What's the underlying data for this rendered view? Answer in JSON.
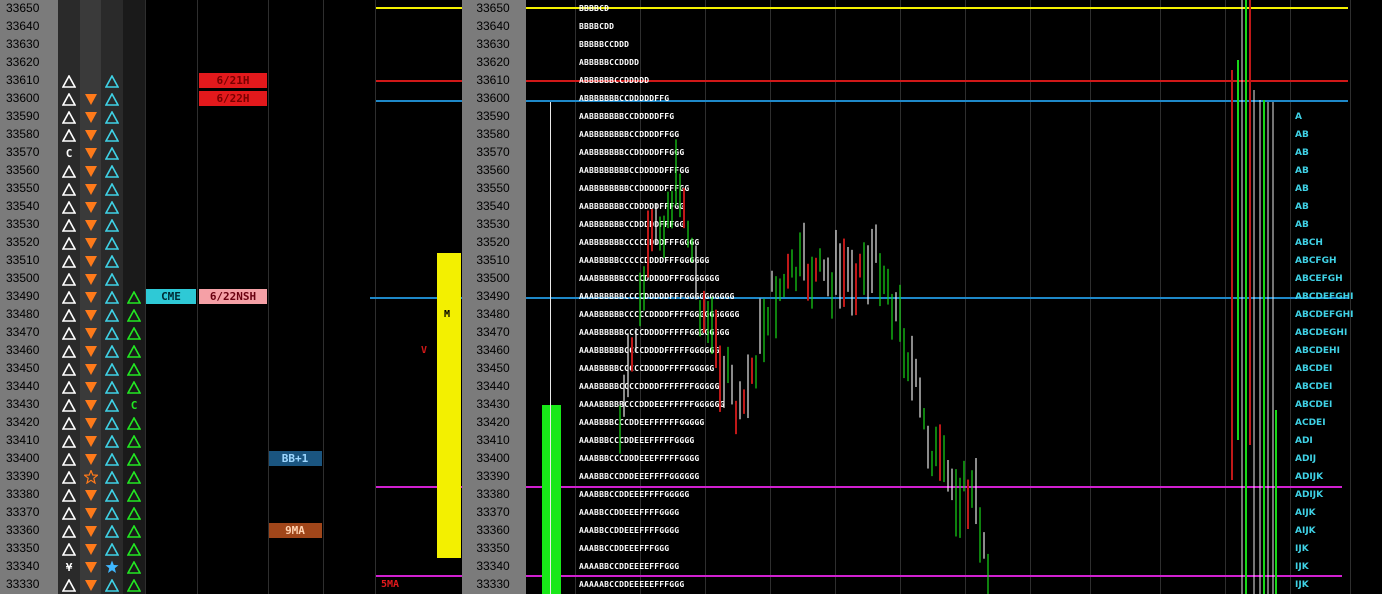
{
  "prices": [
    "33650",
    "33640",
    "33630",
    "33620",
    "33610",
    "33600",
    "33590",
    "33580",
    "33570",
    "33560",
    "33550",
    "33540",
    "33530",
    "33520",
    "33510",
    "33500",
    "33490",
    "33480",
    "33470",
    "33460",
    "33450",
    "33440",
    "33430",
    "33420",
    "33410",
    "33400",
    "33390",
    "33380",
    "33370",
    "33360",
    "33350",
    "33340",
    "33330"
  ],
  "signals": {
    "col1": [
      "",
      "",
      "",
      "",
      "tri-w",
      "tri-w",
      "tri-w",
      "tri-w",
      "C",
      "tri-w",
      "tri-w",
      "tri-w",
      "tri-w",
      "tri-w",
      "tri-w",
      "tri-w",
      "tri-w",
      "tri-w",
      "tri-w",
      "tri-w",
      "tri-w",
      "tri-w",
      "tri-w",
      "tri-w",
      "tri-w",
      "tri-w",
      "tri-w",
      "tri-w",
      "tri-w",
      "tri-w",
      "tri-w",
      "¥",
      "tri-w"
    ],
    "col2": [
      "",
      "",
      "",
      "",
      "",
      "down",
      "down",
      "down",
      "down",
      "down",
      "down",
      "down",
      "down",
      "down",
      "down",
      "down",
      "down",
      "down",
      "down",
      "down",
      "down",
      "down",
      "down",
      "down",
      "down",
      "down",
      "star-o",
      "down",
      "down",
      "down",
      "down",
      "down",
      "down"
    ],
    "col3": [
      "",
      "",
      "",
      "",
      "tri-c",
      "tri-c",
      "tri-c",
      "tri-c",
      "tri-c",
      "tri-c",
      "tri-c",
      "tri-c",
      "tri-c",
      "tri-c",
      "tri-c",
      "tri-c",
      "tri-c",
      "tri-c",
      "tri-c",
      "tri-c",
      "tri-c",
      "tri-c",
      "tri-c",
      "tri-c",
      "tri-c",
      "tri-c",
      "tri-c",
      "tri-c",
      "tri-c",
      "tri-c",
      "tri-c",
      "star-c",
      "tri-c"
    ],
    "col4": [
      "",
      "",
      "",
      "",
      "",
      "",
      "",
      "",
      "",
      "",
      "",
      "",
      "",
      "",
      "",
      "",
      "tri-g",
      "tri-g",
      "tri-g",
      "tri-g",
      "tri-g",
      "tri-g",
      "C",
      "tri-g",
      "tri-g",
      "tri-g",
      "tri-g",
      "tri-g",
      "tri-g",
      "tri-g",
      "tri-g",
      "tri-g",
      "tri-g"
    ]
  },
  "badges": [
    {
      "text": "6/21H",
      "row": 4,
      "col": "b",
      "bg": "#e3191c",
      "fg": "#7a0000"
    },
    {
      "text": "6/22H",
      "row": 5,
      "col": "b",
      "bg": "#e3191c",
      "fg": "#7a0000"
    },
    {
      "text": "CME",
      "row": 16,
      "col": "a",
      "bg": "#2ec9d6",
      "fg": "#002a33"
    },
    {
      "text": "6/22NSH",
      "row": 16,
      "col": "b",
      "bg": "#f5a0a6",
      "fg": "#6a0010"
    },
    {
      "text": "BB+1",
      "row": 25,
      "col": "c",
      "bg": "#1a5580",
      "fg": "#9fd8ff"
    },
    {
      "text": "9MA",
      "row": 29,
      "col": "c",
      "bg": "#a0461a",
      "fg": "#ffd2b0"
    }
  ],
  "marker_v": "V",
  "marker_m": "M",
  "label_5ma": "5MA",
  "tpo": [
    "BBBBCD",
    "BBBBCDD",
    "BBBBBCCDDD",
    "ABBBBBCCDDDD",
    "ABBBBBBCCDDDDD",
    "ABBBBBBBCCDDDDDFFG",
    "AABBBBBBBCCDDDDDFFG",
    "AABBBBBBBBCCDDDDFFGG",
    "AABBBBBBBCCDDDDDFFGGG",
    "AABBBBBBBBCCDDDDDFFFGG",
    "AABBBBBBBBCCDDDDDFFFGG",
    "AABBBBBBBCCDDDDDFFFGG",
    "AABBBBBBBCCDDDDDFFFGG",
    "AABBBBBBBCCCCDDDDFFFGGGG",
    "AAABBBBBCCCCCDDDDFFFGGGGGG",
    "AAABBBBBBCCCCDDDDDFFFGGGGGGG",
    "AAABBBBBBCCCCDDDDDFFFGGGGGGGGGG",
    "AAABBBBBBCCCCCDDDDFFFFGGGGGGGGGG",
    "AAABBBBBBCCCCDDDDFFFFFGGGGGGGG",
    "AAABBBBBBCCCCDDDDFFFFFGGGGGG",
    "AAABBBBBCCCCCDDDDFFFFFGGGGG",
    "AAABBBBBCCCCDDDDFFFFFFFGGGGG",
    "AAAABBBBBCCCDDDEEFFFFFFGGGGGG",
    "AAABBBBCCCDDEEFFFFFFGGGGG",
    "AAABBBCCCDDEEEFFFFFGGGG",
    "AAABBBCCCDDDEEEFFFFFGGGG",
    "AAABBBCCDDDEEEFFFFGGGGGG",
    "AAABBBCCDDEEEFFFFGGGGG",
    "AAABBCCDDEEEFFFFGGGG",
    "AAABBCCDDEEEFFFFGGGG",
    "AAABBCCDDEEEFFFGGG",
    "AAAABBCCDDEEEEFFFGGG",
    "AAAAABCCDDEEEEEFFFGGG"
  ],
  "right_tpo": [
    "",
    "",
    "",
    "",
    "",
    "",
    "A",
    "AB",
    "AB",
    "AB",
    "AB",
    "AB",
    "AB",
    "ABCH",
    "ABCFGH",
    "ABCEFGH",
    "ABCDEFGHI",
    "ABCDEFGHI",
    "ABCDEGHI",
    "ABCDEHI",
    "ABCDEI",
    "ABCDEI",
    "ABCDEI",
    "ACDEI",
    "ADI",
    "ADIJ",
    "ADIJK",
    "ADIJK",
    "AIJK",
    "AIJK",
    "IJK",
    "IJK",
    "IJK"
  ],
  "colors": {
    "yellow": "#f3f000",
    "red": "#d01818",
    "blue": "#1e88c8",
    "magenta": "#d020d0",
    "green": "#18e818",
    "cyan": "#3fd2e6"
  }
}
